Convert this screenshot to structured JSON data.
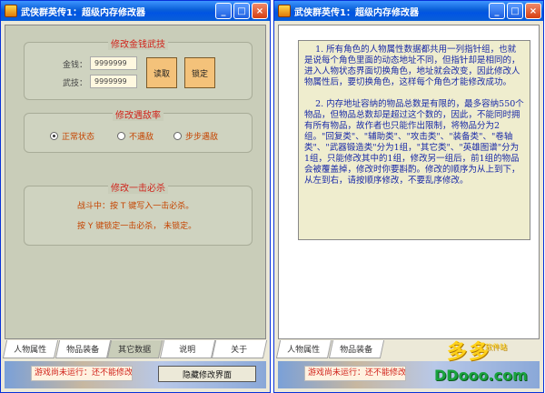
{
  "window_title": "武侠群英传1：超级内存修改器",
  "title_buttons": {
    "minimize": "_",
    "maximize": "□",
    "close": "×"
  },
  "money": {
    "title": "修改金钱武技",
    "gold_label": "金钱：",
    "gold_value": "9999999",
    "skill_label": "武技：",
    "skill_value": "9999999",
    "read_button": "读取",
    "lock_button": "锁定"
  },
  "encounter": {
    "title": "修改遇敌率",
    "options": [
      "正常状态",
      "不遇敌",
      "步步遇敌"
    ],
    "selected": 0
  },
  "onehit": {
    "title": "修改一击必杀",
    "line1": "战斗中：按 T 键写入一击必杀。",
    "line2": "按 Y 键锁定一击必杀， 未锁定。"
  },
  "tabs": [
    "人物属性",
    "物品装备",
    "其它数据",
    "说明",
    "关于"
  ],
  "right_tabs": [
    "人物属性",
    "物品装备"
  ],
  "active_tab": 2,
  "status": "游戏尚未运行：还不能修改。",
  "status_right": "游戏尚未运行：还不能修改",
  "hide_button": "隐藏修改界面",
  "doc_text": "    1. 所有角色的人物属性数据都共用一列指针组，也就是说每个角色里面的动态地址不同，但指针却是相同的，进入人物状态界面切换角色，地址就会改变，因此修改人物属性后，要切换角色，这样每个角色才能修改成功。\n\n    2. 内存地址容纳的物品总数是有限的，最多容纳550个物品，但物品总数却是超过这个数的，因此，不能同时拥有所有物品，故作者也只能作出限制，将物品分为2组。\"回复类\"、\"辅助类\"、\"攻击类\"、\"装备类\"、\"卷轴类\"、\"武器锻造类\"分为1组，\"其它类\"、\"英雄图谱\"分为1组，只能修改其中的1组，修改另一组后，前1组的物品会被覆盖掉，修改时你要斟酌。修改的顺序为从上到下，从左到右，请按顺序修改，不要乱序修改。",
  "watermark": {
    "big": "多多",
    "sub": "软件站",
    "url": "DDooo.com"
  }
}
